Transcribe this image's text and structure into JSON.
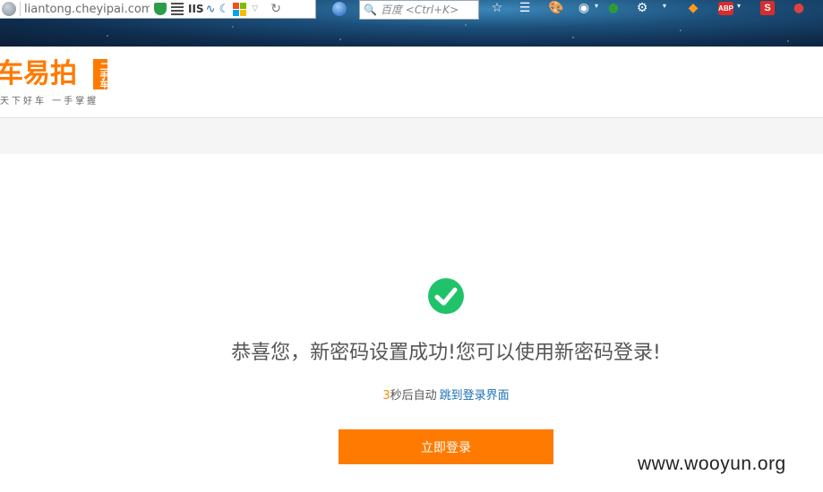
{
  "browser": {
    "url": "liantong.cheyipai.com/P",
    "iis_label": "IIS",
    "search_placeholder": "百度 <Ctrl+K>",
    "abp_label": "ABP",
    "s_label": "S"
  },
  "site": {
    "logo_text": "车易拍",
    "logo_tag": "二手车",
    "logo_slogan": "天下好车 一手掌握"
  },
  "content": {
    "success_message": "恭喜您，新密码设置成功!您可以使用新密码登录!",
    "countdown": "3",
    "redirect_text": "秒后自动",
    "redirect_link": "跳到登录界面",
    "login_button": "立即登录"
  },
  "watermark": "www.wooyun.org",
  "colors": {
    "brand_orange": "#ff7a00",
    "success_green": "#21c36a",
    "link_blue": "#1a6fb5"
  }
}
